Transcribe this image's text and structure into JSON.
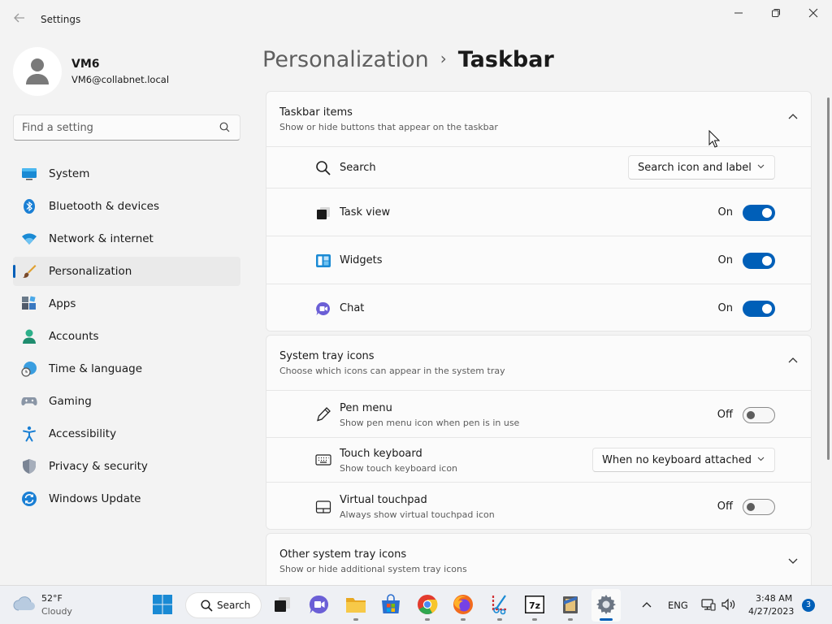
{
  "window": {
    "title": "Settings"
  },
  "profile": {
    "name": "VM6",
    "email": "VM6@collabnet.local"
  },
  "search": {
    "placeholder": "Find a setting"
  },
  "nav": {
    "items": [
      {
        "label": "System",
        "icon": "display-icon"
      },
      {
        "label": "Bluetooth & devices",
        "icon": "bluetooth-icon"
      },
      {
        "label": "Network & internet",
        "icon": "wifi-icon"
      },
      {
        "label": "Personalization",
        "icon": "paintbrush-icon",
        "active": true
      },
      {
        "label": "Apps",
        "icon": "apps-icon"
      },
      {
        "label": "Accounts",
        "icon": "person-icon"
      },
      {
        "label": "Time & language",
        "icon": "globe-clock-icon"
      },
      {
        "label": "Gaming",
        "icon": "gamepad-icon"
      },
      {
        "label": "Accessibility",
        "icon": "accessibility-icon"
      },
      {
        "label": "Privacy & security",
        "icon": "shield-icon"
      },
      {
        "label": "Windows Update",
        "icon": "sync-icon"
      }
    ]
  },
  "breadcrumb": {
    "parent": "Personalization",
    "separator": "›",
    "current": "Taskbar"
  },
  "sections": {
    "taskbar_items": {
      "title": "Taskbar items",
      "subtitle": "Show or hide buttons that appear on the taskbar",
      "rows": {
        "search": {
          "label": "Search",
          "value": "Search icon and label"
        },
        "task_view": {
          "label": "Task view",
          "state": "On"
        },
        "widgets": {
          "label": "Widgets",
          "state": "On"
        },
        "chat": {
          "label": "Chat",
          "state": "On"
        }
      }
    },
    "system_tray": {
      "title": "System tray icons",
      "subtitle": "Choose which icons can appear in the system tray",
      "rows": {
        "pen_menu": {
          "label": "Pen menu",
          "sublabel": "Show pen menu icon when pen is in use",
          "state": "Off"
        },
        "touch_keyboard": {
          "label": "Touch keyboard",
          "sublabel": "Show touch keyboard icon",
          "value": "When no keyboard attached"
        },
        "virtual_touchpad": {
          "label": "Virtual touchpad",
          "sublabel": "Always show virtual touchpad icon",
          "state": "Off"
        }
      }
    },
    "other_tray": {
      "title": "Other system tray icons",
      "subtitle": "Show or hide additional system tray icons"
    }
  },
  "taskbar": {
    "weather": {
      "temp": "52°F",
      "desc": "Cloudy"
    },
    "search_label": "Search",
    "language": "ENG",
    "time": "3:48 AM",
    "date": "4/27/2023",
    "notifications": "3"
  },
  "colors": {
    "accent": "#005fb8",
    "background": "#f3f3f3",
    "card": "#fbfbfb"
  }
}
